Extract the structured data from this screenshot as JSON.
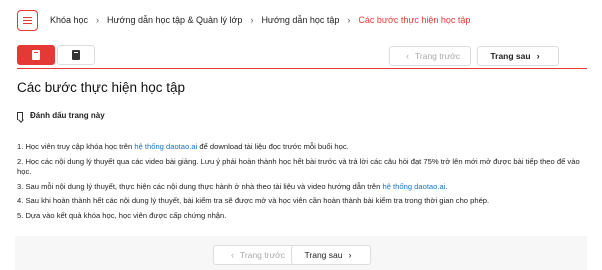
{
  "breadcrumb": {
    "items": [
      "Khóa học",
      "Hướng dẫn học tập & Quản lý lớp",
      "Hướng dẫn học tập",
      "Các bước thực hiện học tập"
    ],
    "separator": "›"
  },
  "nav": {
    "prev_label": "Trang trước",
    "next_label": "Trang sau",
    "prev_chevron": "‹",
    "next_chevron": "›"
  },
  "page": {
    "title": "Các bước thực hiện học tập",
    "bookmark_label": "Đánh dấu trang này"
  },
  "steps": [
    {
      "before": "1. Học viên truy cập khóa học trên ",
      "link": "hệ thống daotao.ai",
      "after": " để download tài liệu đọc trước mỗi buổi học."
    },
    {
      "before": "2. Học các nội dung lý thuyết qua các video bài giảng. Lưu ý phải hoàn thành học hết bài trước và trả lời các câu hỏi đạt 75% trở lên mới mở được bài tiếp theo để vào học.",
      "link": "",
      "after": ""
    },
    {
      "before": "3. Sau mỗi nội dung lý thuyết, thực hiện các nội dung thực hành ở nhà theo tài liệu và video hướng dẫn trên ",
      "link": "hệ thống daotao.ai",
      "after": "."
    },
    {
      "before": "4. Sau khi hoàn thành hết các nội dung lý thuyết, bài kiểm tra sẽ được mở và học viên cần hoàn thành bài kiểm tra trong thời gian cho phép.",
      "link": "",
      "after": ""
    },
    {
      "before": "5. Dựa vào kết quả khóa học, học viên được cấp chứng nhận.",
      "link": "",
      "after": ""
    }
  ],
  "icons": {
    "menu": "menu-icon",
    "tab1": "book-icon",
    "tab2": "book-icon",
    "bookmark": "bookmark-icon"
  },
  "colors": {
    "accent": "#e53935",
    "link": "#1a73c8"
  }
}
